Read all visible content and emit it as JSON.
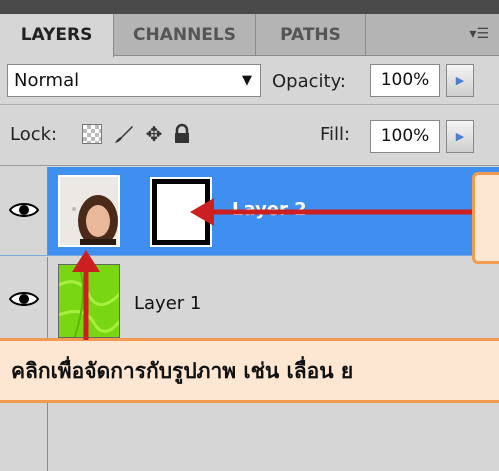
{
  "tabs": [
    {
      "label": "LAYERS",
      "active": true
    },
    {
      "label": "CHANNELS",
      "active": false
    },
    {
      "label": "PATHS",
      "active": false
    }
  ],
  "panel_menu_icon": "panel-menu-icon",
  "blend_mode": "Normal",
  "opacity": {
    "label": "Opacity:",
    "value": "100%"
  },
  "lock": {
    "label": "Lock:",
    "icons": [
      "lock-transparent-icon",
      "lock-paint-icon",
      "lock-move-icon",
      "lock-all-icon"
    ]
  },
  "fill": {
    "label": "Fill:",
    "value": "100%"
  },
  "layers": [
    {
      "name": "Layer 2",
      "selected": true,
      "visible": true,
      "has_mask": true
    },
    {
      "name": "Layer 1",
      "selected": false,
      "visible": true,
      "has_mask": false
    }
  ],
  "annotation": {
    "bottom_text": "คลิกเพื่อจัดการกับรูปภาพ เช่น เลื่อน ย"
  },
  "colors": {
    "selected_row": "#3e8ff0",
    "callout_fill": "#fde7d3",
    "callout_border": "#f29a4e",
    "arrow": "#cc1f1f"
  }
}
